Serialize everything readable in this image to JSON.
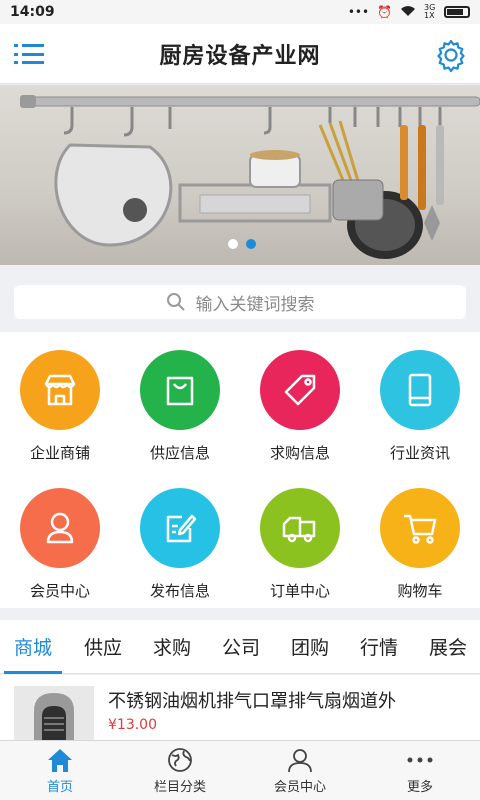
{
  "status_bar": {
    "time": "14:09",
    "signal_label": "3G 1X"
  },
  "header": {
    "title": "厨房设备产业网"
  },
  "banner": {
    "slides": 2,
    "active_slide": 2
  },
  "search": {
    "placeholder": "输入关键词搜索"
  },
  "grid": [
    {
      "label": "企业商铺",
      "icon": "storefront-icon",
      "color": "#f6a21b"
    },
    {
      "label": "供应信息",
      "icon": "shopping-bag-icon",
      "color": "#23b34a"
    },
    {
      "label": "求购信息",
      "icon": "tag-icon",
      "color": "#e8265b"
    },
    {
      "label": "行业资讯",
      "icon": "tablet-icon",
      "color": "#2ec3e0"
    },
    {
      "label": "会员中心",
      "icon": "person-icon",
      "color": "#f56d4b"
    },
    {
      "label": "发布信息",
      "icon": "edit-icon",
      "color": "#26c2e6"
    },
    {
      "label": "订单中心",
      "icon": "truck-icon",
      "color": "#8bc21f"
    },
    {
      "label": "购物车",
      "icon": "cart-icon",
      "color": "#f7b218"
    }
  ],
  "tabs": [
    "商城",
    "供应",
    "求购",
    "公司",
    "团购",
    "行情",
    "展会"
  ],
  "active_tab": "商城",
  "product": {
    "name": "不锈钢油烟机排气口罩排气扇烟道外",
    "price": "¥13.00"
  },
  "bottom_nav": [
    {
      "label": "首页",
      "icon": "home-icon"
    },
    {
      "label": "栏目分类",
      "icon": "globe-icon"
    },
    {
      "label": "会员中心",
      "icon": "person-icon"
    },
    {
      "label": "更多",
      "icon": "more-icon"
    }
  ],
  "colors": {
    "accent": "#1f8ad6",
    "price": "#e03a3a"
  }
}
